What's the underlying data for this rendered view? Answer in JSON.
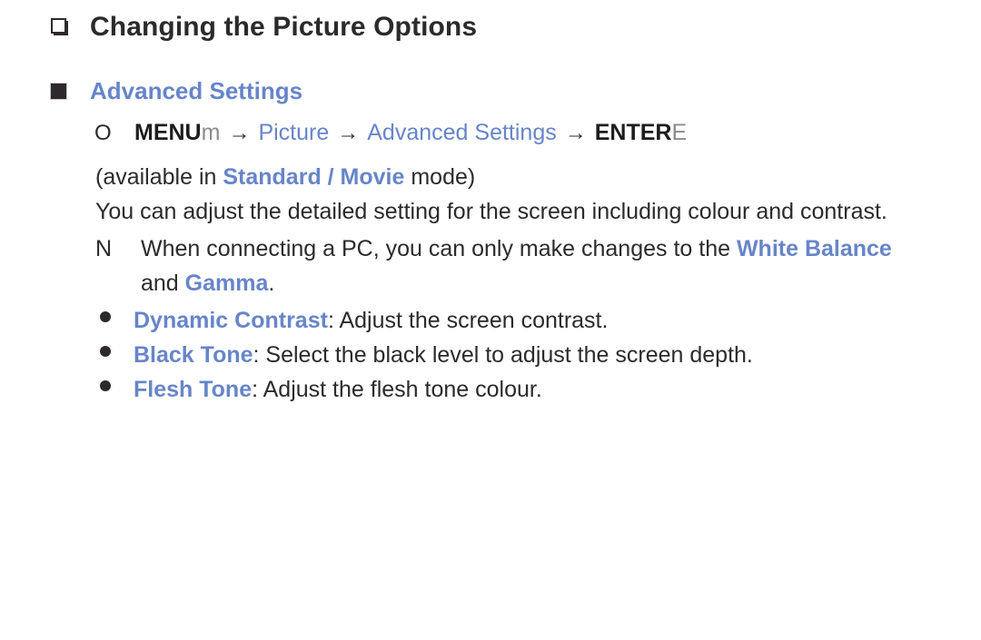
{
  "page": {
    "title": "Changing the Picture Options",
    "title_bullet_icon": "hollow-square-bullet",
    "section": {
      "bullet_icon": "filled-square-bullet",
      "heading": "Advanced Settings"
    },
    "menu_path": {
      "marker": "O",
      "key1_bold": "MENU",
      "key1_light": "m",
      "arrow": "→",
      "step1": "Picture",
      "step2": "Advanced Settings",
      "key2_bold": "ENTER",
      "key2_light": "E"
    },
    "availability": {
      "prefix": "(available in ",
      "modes": "Standard / Movie",
      "suffix": " mode)"
    },
    "description": "You can adjust the detailed setting for the screen including colour and contrast.",
    "note": {
      "marker": "N",
      "text_before": "When connecting a PC, you can only make changes to the ",
      "highlight1": "White Balance",
      "line2_before": "and ",
      "highlight2": "Gamma",
      "line2_after": "."
    },
    "options": [
      {
        "bullet_icon": "round-dot-bullet",
        "label": "Dynamic Contrast",
        "description": ": Adjust the screen contrast."
      },
      {
        "bullet_icon": "round-dot-bullet",
        "label": "Black Tone",
        "description": ": Select the black level to adjust the screen depth."
      },
      {
        "bullet_icon": "round-dot-bullet",
        "label": "Flesh Tone",
        "description": ": Adjust the flesh tone colour."
      }
    ]
  },
  "colors": {
    "accent_blue": "#6785c9",
    "text_dark": "#2b2b2b",
    "key_light": "#8c8c8c",
    "bullet_dark": "#2e292c",
    "background": "#ffffff"
  }
}
